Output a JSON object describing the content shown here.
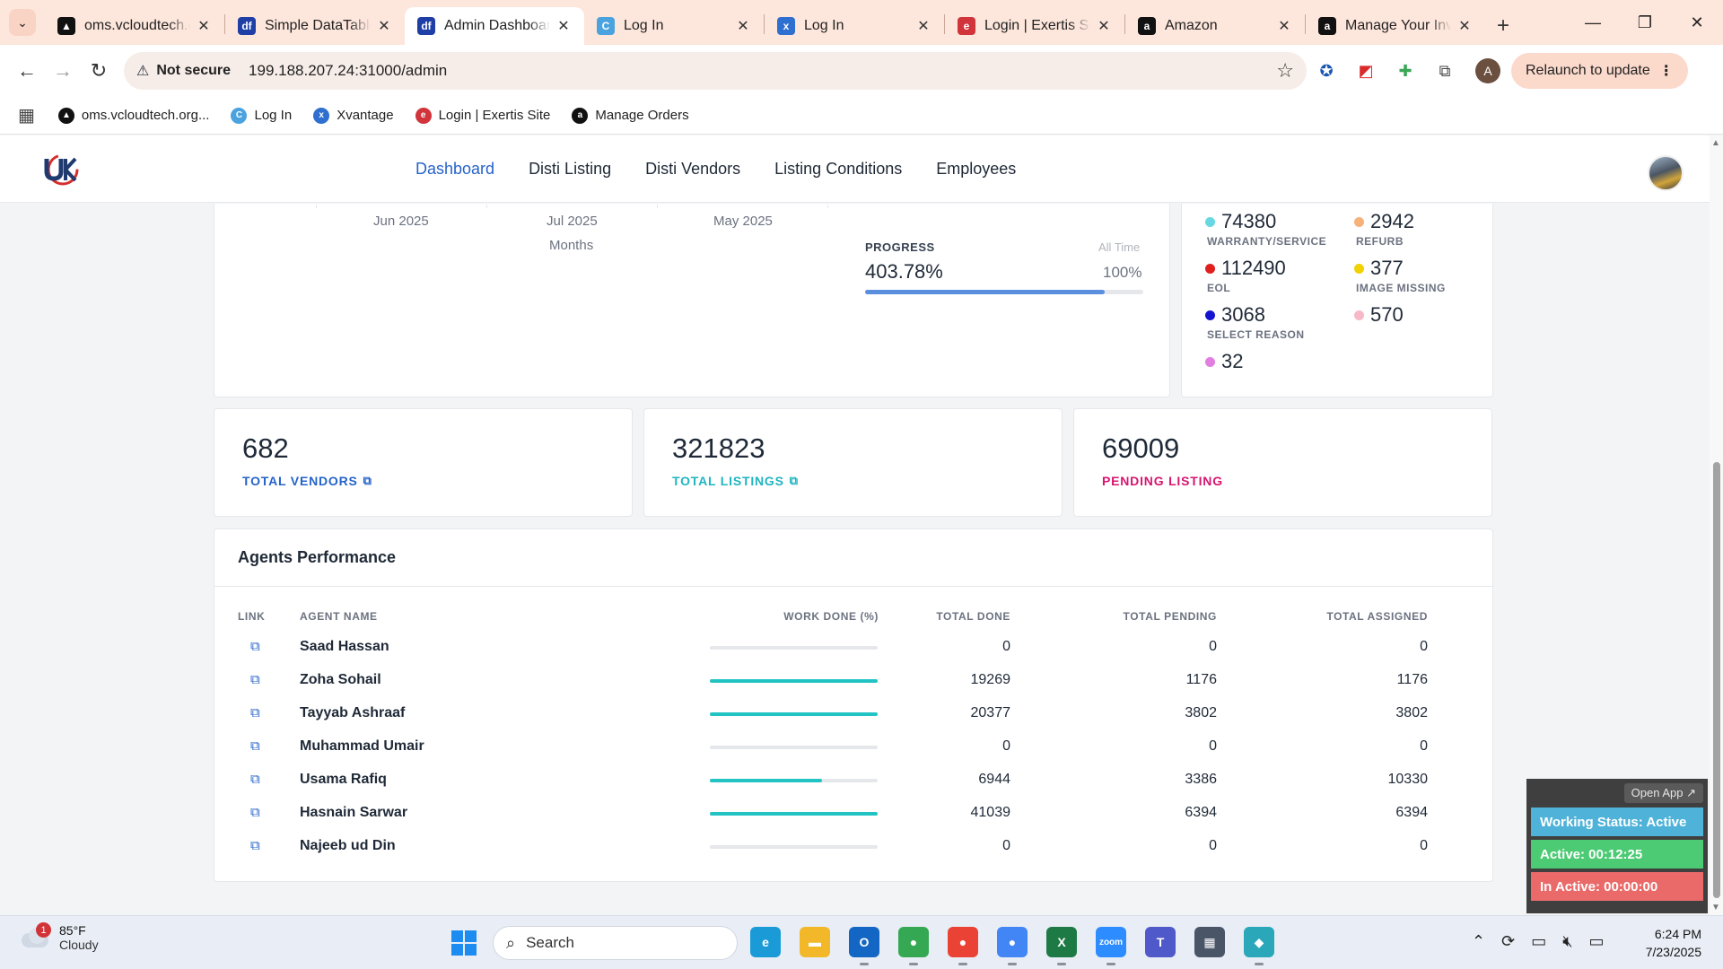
{
  "browser": {
    "tabs": [
      {
        "title": "oms.vcloudtech.org",
        "favicon_color": "#111111",
        "favicon_glyph": "▲",
        "active": false
      },
      {
        "title": "Simple DataTables",
        "favicon_color": "#1f3fa6",
        "favicon_glyph": "df",
        "active": false
      },
      {
        "title": "Admin Dashboard",
        "favicon_color": "#1f3fa6",
        "favicon_glyph": "df",
        "active": true
      },
      {
        "title": "Log In",
        "favicon_color": "#4aa3df",
        "favicon_glyph": "C",
        "active": false
      },
      {
        "title": "Log In",
        "favicon_color": "#2f6fd0",
        "favicon_glyph": "x",
        "active": false
      },
      {
        "title": "Login | Exertis Site",
        "favicon_color": "#d1343a",
        "favicon_glyph": "e",
        "active": false
      },
      {
        "title": "Amazon",
        "favicon_color": "#111111",
        "favicon_glyph": "a",
        "active": false
      },
      {
        "title": "Manage Your Inventory",
        "favicon_color": "#111111",
        "favicon_glyph": "a",
        "active": false
      }
    ],
    "address": {
      "security_label": "Not secure",
      "url": "199.188.207.24:31000/admin"
    },
    "profile_initial": "A",
    "relaunch_label": "Relaunch to update",
    "bookmarks": [
      {
        "label": "oms.vcloudtech.org...",
        "color": "#111111",
        "glyph": "▲"
      },
      {
        "label": "Log In",
        "color": "#4aa3df",
        "glyph": "C"
      },
      {
        "label": "Xvantage",
        "color": "#2f6fd0",
        "glyph": "x"
      },
      {
        "label": "Login | Exertis Site",
        "color": "#d1343a",
        "glyph": "e"
      },
      {
        "label": "Manage Orders",
        "color": "#111111",
        "glyph": "a"
      }
    ]
  },
  "app": {
    "nav": [
      {
        "label": "Dashboard",
        "active": true
      },
      {
        "label": "Disti Listing",
        "active": false
      },
      {
        "label": "Disti Vendors",
        "active": false
      },
      {
        "label": "Listing Conditions",
        "active": false
      },
      {
        "label": "Employees",
        "active": false
      }
    ]
  },
  "chart_card": {
    "months": [
      "Jun 2025",
      "Jul 2025",
      "May 2025"
    ],
    "axis_label": "Months",
    "progress": {
      "label": "PROGRESS",
      "scope": "All Time",
      "value": "403.78%",
      "percent_label": "100%",
      "fill_fraction": 0.86
    }
  },
  "status_counts": [
    {
      "value": "74380",
      "label": "WARRANTY/SERVICE",
      "color": "#67d8e0"
    },
    {
      "value": "2942",
      "label": "REFURB",
      "color": "#f7b27a"
    },
    {
      "value": "112490",
      "label": "EOL",
      "color": "#e0201f"
    },
    {
      "value": "377",
      "label": "IMAGE MISSING",
      "color": "#f2d100"
    },
    {
      "value": "3068",
      "label": "SELECT REASON",
      "color": "#1414d0"
    },
    {
      "value": "570",
      "label": "",
      "color": "#f7b8c8"
    },
    {
      "value": "32",
      "label": "",
      "color": "#e07fe0"
    }
  ],
  "kpis": [
    {
      "value": "682",
      "label": "TOTAL VENDORS",
      "color": "#2563c9",
      "has_link": true
    },
    {
      "value": "321823",
      "label": "TOTAL LISTINGS",
      "color": "#1fb5c0",
      "has_link": true
    },
    {
      "value": "69009",
      "label": "PENDING LISTING",
      "color": "#d8156f",
      "has_link": false
    }
  ],
  "agents": {
    "title": "Agents Performance",
    "columns": {
      "link": "LINK",
      "name": "AGENT NAME",
      "work": "WORK DONE (%)",
      "done": "TOTAL DONE",
      "pending": "TOTAL PENDING",
      "assigned": "TOTAL ASSIGNED"
    },
    "rows": [
      {
        "name": "Saad Hassan",
        "work_fraction": 0,
        "done": "0",
        "pending": "0",
        "assigned": "0"
      },
      {
        "name": "Zoha Sohail",
        "work_fraction": 1,
        "done": "19269",
        "pending": "1176",
        "assigned": "1176"
      },
      {
        "name": "Tayyab Ashraaf",
        "work_fraction": 1,
        "done": "20377",
        "pending": "3802",
        "assigned": "3802"
      },
      {
        "name": "Muhammad Umair",
        "work_fraction": 0,
        "done": "0",
        "pending": "0",
        "assigned": "0"
      },
      {
        "name": "Usama Rafiq",
        "work_fraction": 0.67,
        "done": "6944",
        "pending": "3386",
        "assigned": "10330"
      },
      {
        "name": "Hasnain Sarwar",
        "work_fraction": 1,
        "done": "41039",
        "pending": "6394",
        "assigned": "6394"
      },
      {
        "name": "Najeeb ud Din",
        "work_fraction": 0,
        "done": "0",
        "pending": "0",
        "assigned": "0"
      }
    ]
  },
  "widget": {
    "open_app": "Open App ↗",
    "working_status": "Working Status: Active",
    "active": "Active: 00:12:25",
    "inactive": "In Active: 00:00:00"
  },
  "taskbar": {
    "weather_temp": "85°F",
    "weather_desc": "Cloudy",
    "weather_badge": "1",
    "search_placeholder": "Search",
    "time": "6:24 PM",
    "date": "7/23/2025",
    "apps": [
      {
        "name": "edge-icon",
        "color": "#1a9bd7",
        "glyph": "e",
        "running": false
      },
      {
        "name": "file-explorer-icon",
        "color": "#f2b829",
        "glyph": "▬",
        "running": false
      },
      {
        "name": "outlook-icon",
        "color": "#1366c4",
        "glyph": "O",
        "running": true
      },
      {
        "name": "chrome-icon",
        "color": "#34a853",
        "glyph": "●",
        "running": true
      },
      {
        "name": "chrome-profile-icon",
        "color": "#ea4335",
        "glyph": "●",
        "running": true
      },
      {
        "name": "chrome-active-icon",
        "color": "#4285f4",
        "glyph": "●",
        "running": true
      },
      {
        "name": "excel-icon",
        "color": "#1d7a45",
        "glyph": "X",
        "running": true
      },
      {
        "name": "zoom-icon",
        "color": "#2d8cff",
        "glyph": "zoom",
        "running": true
      },
      {
        "name": "teams-icon",
        "color": "#5059c9",
        "glyph": "T",
        "running": false
      },
      {
        "name": "calculator-icon",
        "color": "#4a5568",
        "glyph": "▦",
        "running": false
      },
      {
        "name": "app-diamond-icon",
        "color": "#2aa7b8",
        "glyph": "◆",
        "running": true
      }
    ]
  }
}
